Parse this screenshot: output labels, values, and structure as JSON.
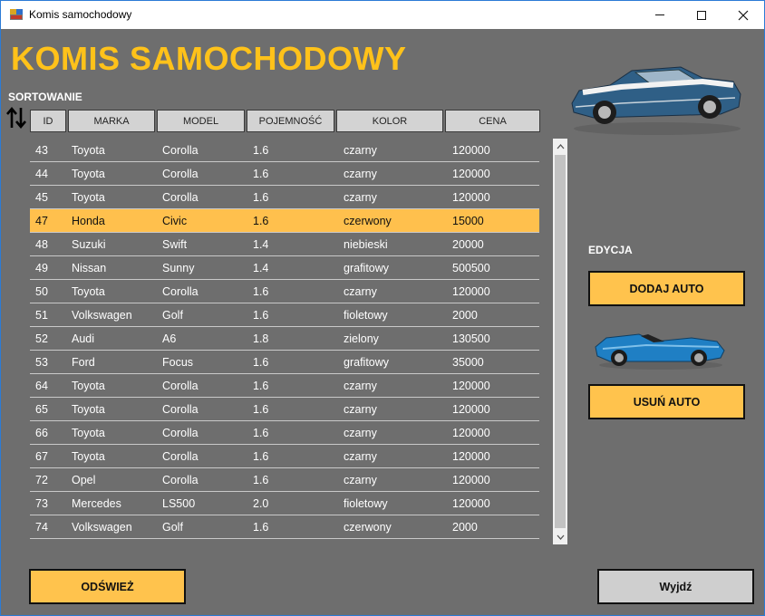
{
  "window": {
    "title": "Komis samochodowy"
  },
  "header": {
    "title": "KOMIS SAMOCHODOWY",
    "sort_label": "SORTOWANIE"
  },
  "grid": {
    "columns": [
      "ID",
      "MARKA",
      "MODEL",
      "POJEMNOŚĆ",
      "KOLOR",
      "CENA"
    ],
    "selected_index": 3,
    "rows": [
      [
        "43",
        "Toyota",
        "Corolla",
        "1.6",
        "czarny",
        "120000"
      ],
      [
        "44",
        "Toyota",
        "Corolla",
        "1.6",
        "czarny",
        "120000"
      ],
      [
        "45",
        "Toyota",
        "Corolla",
        "1.6",
        "czarny",
        "120000"
      ],
      [
        "47",
        "Honda",
        "Civic",
        "1.6",
        "czerwony",
        "15000"
      ],
      [
        "48",
        "Suzuki",
        "Swift",
        "1.4",
        "niebieski",
        "20000"
      ],
      [
        "49",
        "Nissan",
        "Sunny",
        "1.4",
        "grafitowy",
        "500500"
      ],
      [
        "50",
        "Toyota",
        "Corolla",
        "1.6",
        "czarny",
        "120000"
      ],
      [
        "51",
        "Volkswagen",
        "Golf",
        "1.6",
        "fioletowy",
        "2000"
      ],
      [
        "52",
        "Audi",
        "A6",
        "1.8",
        "zielony",
        "130500"
      ],
      [
        "53",
        "Ford",
        "Focus",
        "1.6",
        "grafitowy",
        "35000"
      ],
      [
        "64",
        "Toyota",
        "Corolla",
        "1.6",
        "czarny",
        "120000"
      ],
      [
        "65",
        "Toyota",
        "Corolla",
        "1.6",
        "czarny",
        "120000"
      ],
      [
        "66",
        "Toyota",
        "Corolla",
        "1.6",
        "czarny",
        "120000"
      ],
      [
        "67",
        "Toyota",
        "Corolla",
        "1.6",
        "czarny",
        "120000"
      ],
      [
        "72",
        "Opel",
        "Corolla",
        "1.6",
        "czarny",
        "120000"
      ],
      [
        "73",
        "Mercedes",
        "LS500",
        "2.0",
        "fioletowy",
        "120000"
      ],
      [
        "74",
        "Volkswagen",
        "Golf",
        "1.6",
        "czerwony",
        "2000"
      ]
    ]
  },
  "side": {
    "edit_label": "EDYCJA",
    "add_button": "DODAJ AUTO",
    "remove_button": "USUŃ AUTO"
  },
  "footer": {
    "refresh_button": "ODŚWIEŻ",
    "exit_button": "Wyjdź"
  },
  "colors": {
    "accent": "#ffc21a",
    "button": "#ffc34d",
    "selected_row": "#ffc04d",
    "background": "#6e6e6e"
  },
  "icons": {
    "app": "app-window-icon",
    "sort": "sort-arrows-icon",
    "car_top": "muscle-car-image",
    "car_mid": "convertible-car-image"
  }
}
